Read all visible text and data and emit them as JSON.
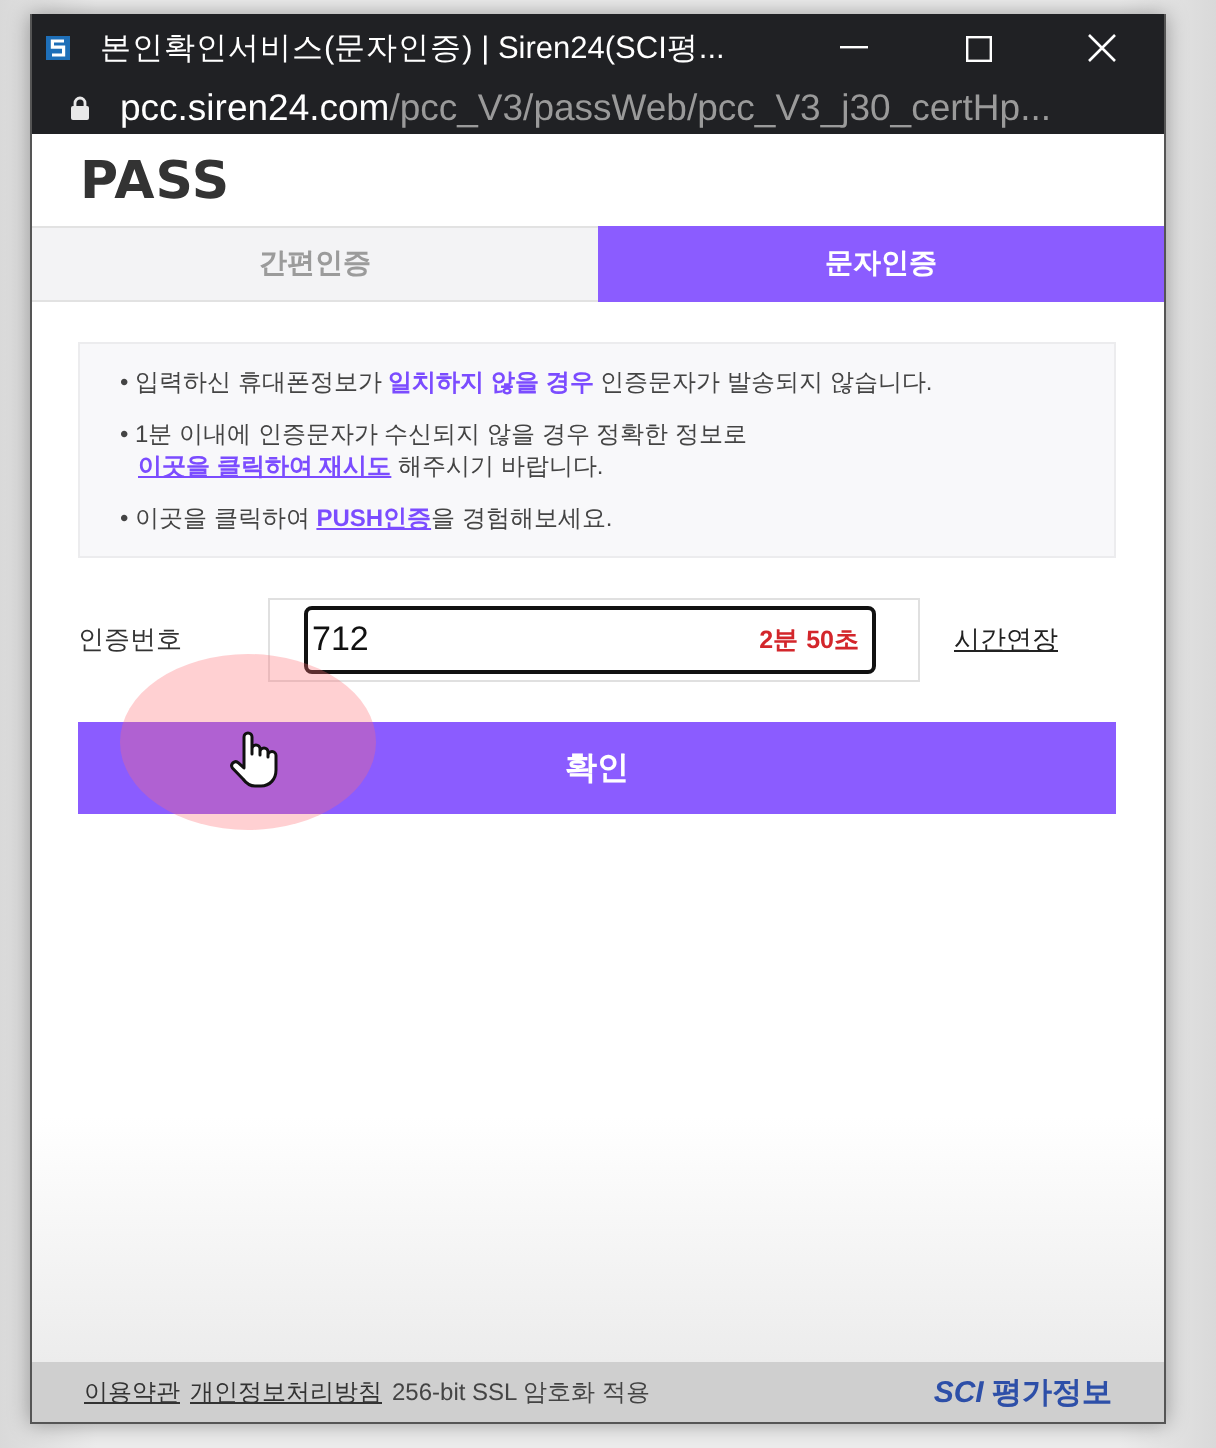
{
  "window": {
    "title": "본인확인서비스(문자인증) | Siren24(SCI평...",
    "url_host": "pcc.siren24.com",
    "url_path": "/pcc_V3/passWeb/pcc_V3_j30_certHp..."
  },
  "logo": "PASS",
  "tabs": [
    {
      "label": "간편인증",
      "selected": false
    },
    {
      "label": "문자인증",
      "selected": true
    }
  ],
  "notice": [
    {
      "text": "• 입력하신 휴대폰정보가 **일치하지 않을 경우** 인증문자가 발송되지 않습니다."
    },
    {
      "text": "• 1분 이내에 인증문자가 수신되지 않을 경우 정확한 정보로",
      "link": "이곳을 클릭하여 재시도",
      "after": " 해주시기 바랍니다.",
      "link_on_new_line": true
    },
    {
      "text": "• 이곳을 클릭하여 ",
      "link": "PUSH인증",
      "after": "을 경험해보세요.",
      "link_on_new_line": false
    }
  ],
  "code_field": {
    "label": "인증번호",
    "value": "712",
    "timer": "2분 50초",
    "focused": true
  },
  "extend_link": "시간연장",
  "confirm_button": "확인",
  "footer": {
    "links": [
      "이용약관",
      "개인정보처리방침"
    ],
    "note": "256-bit SSL 암호화 적용",
    "brand": "*SCI* 평가정보"
  }
}
